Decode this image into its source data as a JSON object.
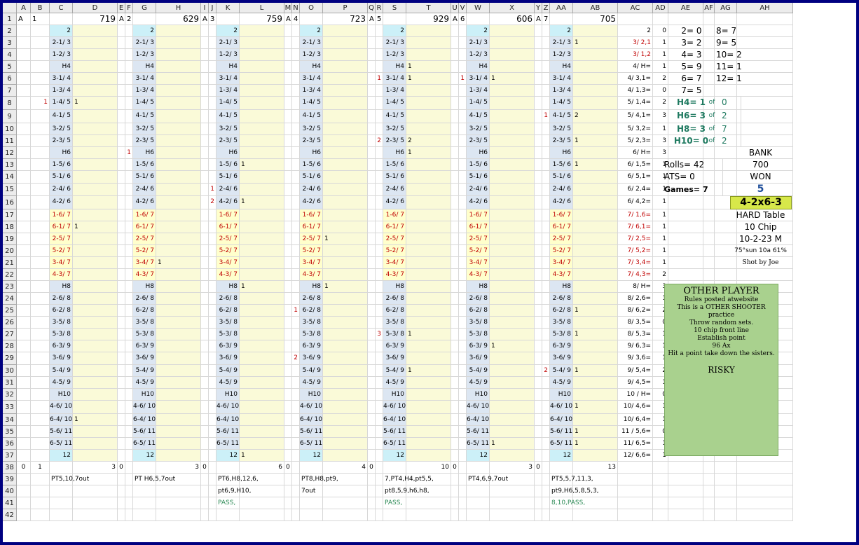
{
  "columns": [
    "A",
    "B",
    "C",
    "D",
    "E",
    "F",
    "G",
    "H",
    "I",
    "J",
    "K",
    "L",
    "M",
    "N",
    "O",
    "P",
    "Q",
    "R",
    "S",
    "T",
    "U",
    "V",
    "W",
    "X",
    "Y",
    "Z",
    "AA",
    "AB",
    "AC",
    "AD",
    "AE",
    "AF",
    "AG",
    "AH"
  ],
  "rows": [
    "1",
    "2",
    "3",
    "4",
    "5",
    "6",
    "7",
    "8",
    "9",
    "10",
    "11",
    "12",
    "13",
    "14",
    "15",
    "16",
    "17",
    "18",
    "19",
    "20",
    "21",
    "22",
    "23",
    "24",
    "25",
    "26",
    "27",
    "28",
    "29",
    "30",
    "31",
    "32",
    "33",
    "34",
    "35",
    "36",
    "37",
    "38",
    "39",
    "40",
    "41",
    "42"
  ],
  "labels": [
    "2",
    "2-1/ 3",
    "1-2/ 3",
    "H4",
    "3-1/ 4",
    "1-3/ 4",
    "1-4/ 5",
    "4-1/ 5",
    "3-2/ 5",
    "2-3/ 5",
    "H6",
    "1-5/ 6",
    "5-1/ 6",
    "2-4/ 6",
    "4-2/ 6",
    "1-6/ 7",
    "6-1/ 7",
    "2-5/ 7",
    "5-2/ 7",
    "3-4/ 7",
    "4-3/ 7",
    "H8",
    "2-6/ 8",
    "6-2/ 8",
    "3-5/ 8",
    "5-3/ 8",
    "6-3/ 9",
    "3-6/ 9",
    "5-4/ 9",
    "4-5/ 9",
    "H10",
    "4-6/ 10",
    "6-4/ 10",
    "5-6/ 11",
    "6-5/ 11",
    "12"
  ],
  "blocks": [
    {
      "letter": "A",
      "num": "1",
      "total": "719",
      "sum": "3",
      "zero": "0",
      "one": "1",
      "notes": [
        "PT5,10,7out",
        "",
        ""
      ],
      "marks": [
        {
          "row": 8,
          "side": "left",
          "text": "1"
        },
        {
          "row": 8,
          "side": "right",
          "text": "1"
        },
        {
          "row": 18,
          "side": "right",
          "text": "1"
        },
        {
          "row": 34,
          "side": "right",
          "text": "1"
        }
      ]
    },
    {
      "letter": "A",
      "num": "2",
      "total": "629",
      "sum": "3",
      "zero": "0",
      "one": "",
      "notes": [
        "PT H6,5,7out",
        "",
        ""
      ],
      "marks": [
        {
          "row": 12,
          "side": "left",
          "text": "1"
        },
        {
          "row": 21,
          "side": "right",
          "text": "1"
        }
      ]
    },
    {
      "letter": "A",
      "num": "3",
      "total": "759",
      "sum": "6",
      "zero": "0",
      "one": "",
      "notes": [
        "PT6,H8,12,6,",
        "pt6,9,H10,",
        "PASS,"
      ],
      "marks": [
        {
          "row": 15,
          "side": "left",
          "text": "1"
        },
        {
          "row": 16,
          "side": "left",
          "text": "2"
        },
        {
          "row": 13,
          "side": "right",
          "text": "1"
        },
        {
          "row": 16,
          "side": "right",
          "text": "1"
        },
        {
          "row": 23,
          "side": "right",
          "text": "1"
        },
        {
          "row": 37,
          "side": "right",
          "text": "1"
        }
      ]
    },
    {
      "letter": "A",
      "num": "4",
      "total": "723",
      "sum": "4",
      "zero": "0",
      "one": "",
      "notes": [
        "PT8,H8,pt9,",
        "7out",
        ""
      ],
      "marks": [
        {
          "row": 25,
          "side": "left",
          "text": "1"
        },
        {
          "row": 29,
          "side": "left",
          "text": "2"
        },
        {
          "row": 19,
          "side": "right",
          "text": "1"
        },
        {
          "row": 23,
          "side": "right",
          "text": "1"
        }
      ]
    },
    {
      "letter": "A",
      "num": "5",
      "total": "929",
      "sum": "10",
      "zero": "0",
      "one": "",
      "notes": [
        "7,PT4,H4,pt5,5,",
        "pt8,5,9,h6,h8,",
        "PASS,"
      ],
      "marks": [
        {
          "row": 6,
          "side": "left",
          "text": "1"
        },
        {
          "row": 11,
          "side": "left",
          "text": "2"
        },
        {
          "row": 27,
          "side": "left",
          "text": "3"
        },
        {
          "row": 5,
          "side": "right",
          "text": "1"
        },
        {
          "row": 6,
          "side": "right",
          "text": "1"
        },
        {
          "row": 11,
          "side": "right",
          "text": "2"
        },
        {
          "row": 12,
          "side": "right",
          "text": "1"
        },
        {
          "row": 27,
          "side": "right",
          "text": "1"
        },
        {
          "row": 30,
          "side": "right",
          "text": "1"
        }
      ]
    },
    {
      "letter": "A",
      "num": "6",
      "total": "606",
      "sum": "3",
      "zero": "0",
      "one": "",
      "notes": [
        "PT4,6,9,7out",
        "",
        ""
      ],
      "marks": [
        {
          "row": 6,
          "side": "left",
          "text": "1"
        },
        {
          "row": 6,
          "side": "right",
          "text": "1"
        },
        {
          "row": 28,
          "side": "right",
          "text": "1"
        },
        {
          "row": 36,
          "side": "right",
          "text": "1"
        }
      ]
    },
    {
      "letter": "A",
      "num": "7",
      "total": "705",
      "sum": "13",
      "zero": "0",
      "one": "",
      "notes": [
        "PT5,5,7,11,3,",
        "pt9,H6,5,8,5,3,",
        "8,10,PASS,"
      ],
      "marks": [
        {
          "row": 9,
          "side": "left",
          "text": "1"
        },
        {
          "row": 30,
          "side": "left",
          "text": "2"
        },
        {
          "row": 3,
          "side": "right",
          "text": "1"
        },
        {
          "row": 9,
          "side": "right",
          "text": "2"
        },
        {
          "row": 11,
          "side": "right",
          "text": "1"
        },
        {
          "row": 13,
          "side": "right",
          "text": "1"
        },
        {
          "row": 25,
          "side": "right",
          "text": "1"
        },
        {
          "row": 27,
          "side": "right",
          "text": "1"
        },
        {
          "row": 30,
          "side": "right",
          "text": "1"
        },
        {
          "row": 33,
          "side": "right",
          "text": "1"
        },
        {
          "row": 35,
          "side": "right",
          "text": "1"
        },
        {
          "row": 36,
          "side": "right",
          "text": "1"
        }
      ]
    }
  ],
  "ac": [
    "2",
    "3/ 2,1",
    "3/ 1,2",
    "4/ H=",
    "4/ 3,1=",
    "4/ 1,3=",
    "5/ 1,4=",
    "5/ 4,1=",
    "5/ 3,2=",
    "5/ 2,3=",
    "6/ H=",
    "6/ 1,5=",
    "6/ 5,1=",
    "6/ 2,4=",
    "6/ 4,2=",
    "7/ 1,6=",
    "7/ 6,1=",
    "7/ 2,5=",
    "7/ 5,2=",
    "7/ 3,4=",
    "7/ 4,3=",
    "8/ H=",
    "8/ 2,6=",
    "8/ 6,2=",
    "8/ 3,5=",
    "8/ 5,3=",
    "9/ 6,3=",
    "9/ 3,6=",
    "9/ 5,4=",
    "9/ 4,5=",
    "10 / H=",
    "10/ 4,6=",
    "10/ 6,4=",
    "11 / 5,6=",
    "11/ 6,5=",
    "12/ 6,6="
  ],
  "ad": [
    "0",
    "1",
    "1",
    "1",
    "2",
    "0",
    "2",
    "3",
    "1",
    "3",
    "3",
    "1",
    "1",
    "1",
    "1",
    "1",
    "1",
    "1",
    "1",
    "1",
    "2",
    "3",
    "1",
    "2",
    "0",
    "1",
    "1",
    "1",
    "2",
    "1",
    "0",
    "1",
    "1",
    "0",
    "1",
    "1"
  ],
  "side": {
    "counts_left": [
      "2= 0",
      "3= 2",
      "4= 3",
      "5= 9",
      "6= 7",
      "7= 5"
    ],
    "counts_right": [
      "8= 7",
      "9= 5",
      "10= 2",
      "11= 1",
      "12= 1"
    ],
    "hards": [
      {
        "label": "H4= 1",
        "of": "of",
        "val": "0"
      },
      {
        "label": "H6= 3",
        "of": "of",
        "val": "2"
      },
      {
        "label": "H8= 3",
        "of": "of",
        "val": "7"
      },
      {
        "label": "H10= 0",
        "of": "of",
        "val": "2"
      }
    ],
    "bank_label": "BANK",
    "bank_value": "700",
    "won_label": "WON",
    "won_value": "5",
    "rolls": "Rolls= 42",
    "ats": "ATS= 0",
    "games": "Games= 7",
    "set": "4-2x6-3",
    "table": "HARD Table",
    "chip": "10 Chip",
    "date": "10-2-23 M",
    "weather": "75°sun 10a 61%",
    "shot": "Shot by Joe"
  },
  "panel": {
    "title": "OTHER PLAYER",
    "lines": [
      "Rules posted atwebsite",
      "This is a OTHER SHOOTER practice",
      "Throw random sets.",
      "10 chip front line",
      "Establish point",
      "96 Ax",
      "Hit a point take down the sisters."
    ],
    "risky": "RISKY"
  },
  "colors": {
    "label_blue": "#dce6f2",
    "label_cyan": "#ccf0f8",
    "yellow": "#ffffcc",
    "panel": "#a9d18e",
    "red": "#c00000",
    "green": "#2e8b57",
    "highlight": "#d7e84a"
  }
}
